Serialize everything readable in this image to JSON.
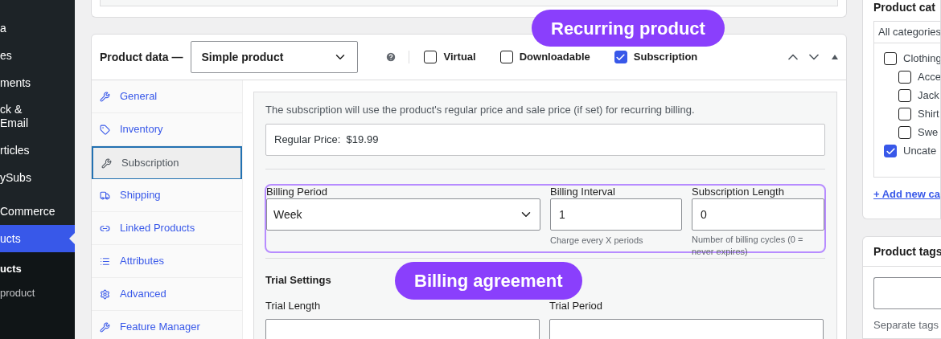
{
  "admin_menu": {
    "items": [
      {
        "label": "a",
        "active": false
      },
      {
        "label": "es",
        "active": false
      },
      {
        "label": "ments",
        "active": false
      },
      {
        "label": "ck &\nEmail",
        "active": false
      },
      {
        "label": "rticles",
        "active": false
      },
      {
        "label": "ySubs",
        "active": false
      },
      {
        "label": "Commerce",
        "active": false
      },
      {
        "label": "ucts",
        "active": true
      }
    ],
    "submenu": [
      {
        "label": "ucts",
        "selected": true
      },
      {
        "label": "product",
        "selected": false
      }
    ]
  },
  "product_data": {
    "title": "Product data —",
    "type_select": "Simple product",
    "options": [
      {
        "label": "Virtual",
        "checked": false
      },
      {
        "label": "Downloadable",
        "checked": false
      },
      {
        "label": "Subscription",
        "checked": true
      }
    ],
    "tabs": [
      {
        "label": "General",
        "selected": false
      },
      {
        "label": "Inventory",
        "selected": false
      },
      {
        "label": "Subscription",
        "selected": true
      },
      {
        "label": "Shipping",
        "selected": false
      },
      {
        "label": "Linked Products",
        "selected": false
      },
      {
        "label": "Attributes",
        "selected": false
      },
      {
        "label": "Advanced",
        "selected": false
      },
      {
        "label": "Feature Manager",
        "selected": false
      }
    ],
    "panel": {
      "note": "The subscription will use the product's regular price and sale price (if set) for recurring billing.",
      "regular_price_label": "Regular Price:",
      "regular_price": "$19.99",
      "billing_period": {
        "label": "Billing Period",
        "value": "Week"
      },
      "billing_interval": {
        "label": "Billing Interval",
        "value": "1",
        "help": "Charge every X periods"
      },
      "subscription_length": {
        "label": "Subscription Length",
        "value": "0",
        "help": "Number of billing cycles (0 = never expires)"
      },
      "trial_title": "Trial Settings",
      "trial_length_label": "Trial Length",
      "trial_period_label": "Trial Period"
    }
  },
  "callouts": [
    {
      "text": "Recurring product"
    },
    {
      "text": "Billing agreement"
    }
  ],
  "categories": {
    "title": "Product cat",
    "tab": "All categories",
    "items": [
      {
        "label": "Clothing",
        "checked": false,
        "children": [
          {
            "label": "Acce",
            "checked": false
          },
          {
            "label": "Jack",
            "checked": false
          },
          {
            "label": "Shirt",
            "checked": false
          },
          {
            "label": "Swe",
            "checked": false
          }
        ]
      },
      {
        "label": "Uncate",
        "checked": true
      }
    ],
    "add_link": "+ Add new ca"
  },
  "tags": {
    "title": "Product tags",
    "help": "Separate tags"
  }
}
